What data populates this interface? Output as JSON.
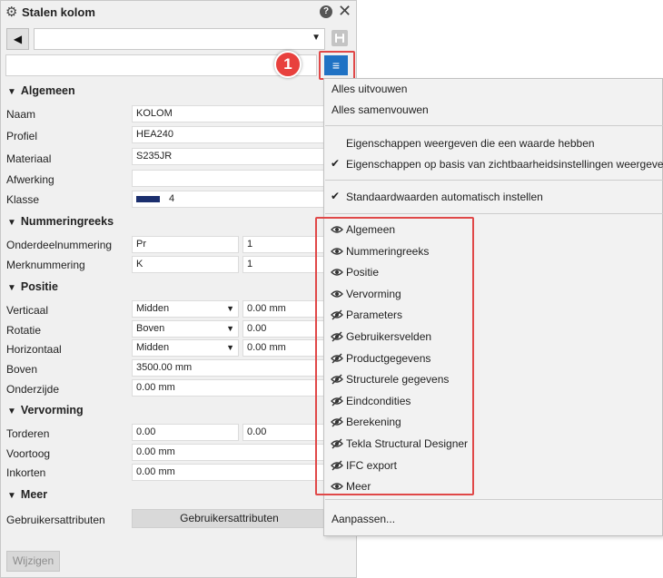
{
  "panel": {
    "title": "Stalen kolom",
    "help_glyph": "?",
    "close_glyph": "✕",
    "back_glyph": "◀",
    "preset_value": "",
    "search_value": "",
    "badge_number": "1",
    "menu_glyph": "≡"
  },
  "sections": {
    "algemeen": "Algemeen",
    "nummeringreeks": "Nummeringreeks",
    "positie": "Positie",
    "vervorming": "Vervorming",
    "meer": "Meer"
  },
  "algemeen": {
    "naam_label": "Naam",
    "naam_value": "KOLOM",
    "profiel_label": "Profiel",
    "profiel_value": "HEA240",
    "materiaal_label": "Materiaal",
    "materiaal_value": "S235JR",
    "afwerking_label": "Afwerking",
    "afwerking_value": "",
    "klasse_label": "Klasse",
    "klasse_value": "4",
    "klasse_color": "#1b2f6e"
  },
  "nummering": {
    "onderdeel_label": "Onderdeelnummering",
    "onderdeel_prefix": "Pr",
    "onderdeel_start": "1",
    "merk_label": "Merknummering",
    "merk_prefix": "K",
    "merk_start": "1"
  },
  "positie": {
    "verticaal_label": "Verticaal",
    "verticaal_value": "Midden",
    "verticaal_offset": "0.00 mm",
    "rotatie_label": "Rotatie",
    "rotatie_value": "Boven",
    "rotatie_offset": "0.00",
    "horizontaal_label": "Horizontaal",
    "horizontaal_value": "Midden",
    "horizontaal_offset": "0.00 mm",
    "boven_label": "Boven",
    "boven_value": "3500.00 mm",
    "onderzijde_label": "Onderzijde",
    "onderzijde_value": "0.00 mm"
  },
  "vervorming": {
    "torderen_label": "Torderen",
    "torderen_start": "0.00",
    "torderen_end": "0.00",
    "voortoog_label": "Voortoog",
    "voortoog_value": "0.00 mm",
    "inkorten_label": "Inkorten",
    "inkorten_value": "0.00 mm"
  },
  "meer": {
    "gebruikers_label": "Gebruikersattributen",
    "gebruikers_button": "Gebruikersattributen"
  },
  "footer": {
    "modify_button": "Wijzigen"
  },
  "menu": {
    "expand_all": "Alles uitvouwen",
    "collapse_all": "Alles samenvouwen",
    "show_with_value": "Eigenschappen weergeven die een waarde hebben",
    "show_by_visibility": "Eigenschappen op basis van zichtbaarheidsinstellingen weergeven",
    "auto_defaults": "Standaardwaarden automatisch instellen",
    "sections": [
      {
        "label": "Algemeen",
        "icon": "eye-icon"
      },
      {
        "label": "Nummeringreeks",
        "icon": "eye-icon"
      },
      {
        "label": "Positie",
        "icon": "eye-icon"
      },
      {
        "label": "Vervorming",
        "icon": "eye-icon"
      },
      {
        "label": "Parameters",
        "icon": "eye-off-icon"
      },
      {
        "label": "Gebruikersvelden",
        "icon": "eye-off-icon"
      },
      {
        "label": "Productgegevens",
        "icon": "eye-off-icon"
      },
      {
        "label": "Structurele gegevens",
        "icon": "eye-off-icon"
      },
      {
        "label": "Eindcondities",
        "icon": "eye-off-icon"
      },
      {
        "label": "Berekening",
        "icon": "eye-off-icon"
      },
      {
        "label": "Tekla Structural Designer",
        "icon": "eye-off-icon"
      },
      {
        "label": "IFC export",
        "icon": "eye-off-icon"
      },
      {
        "label": "Meer",
        "icon": "eye-icon"
      }
    ],
    "customize": "Aanpassen..."
  },
  "colors": {
    "accent": "#1f72c4",
    "highlight": "#e04848",
    "badge": "#e8403d"
  }
}
